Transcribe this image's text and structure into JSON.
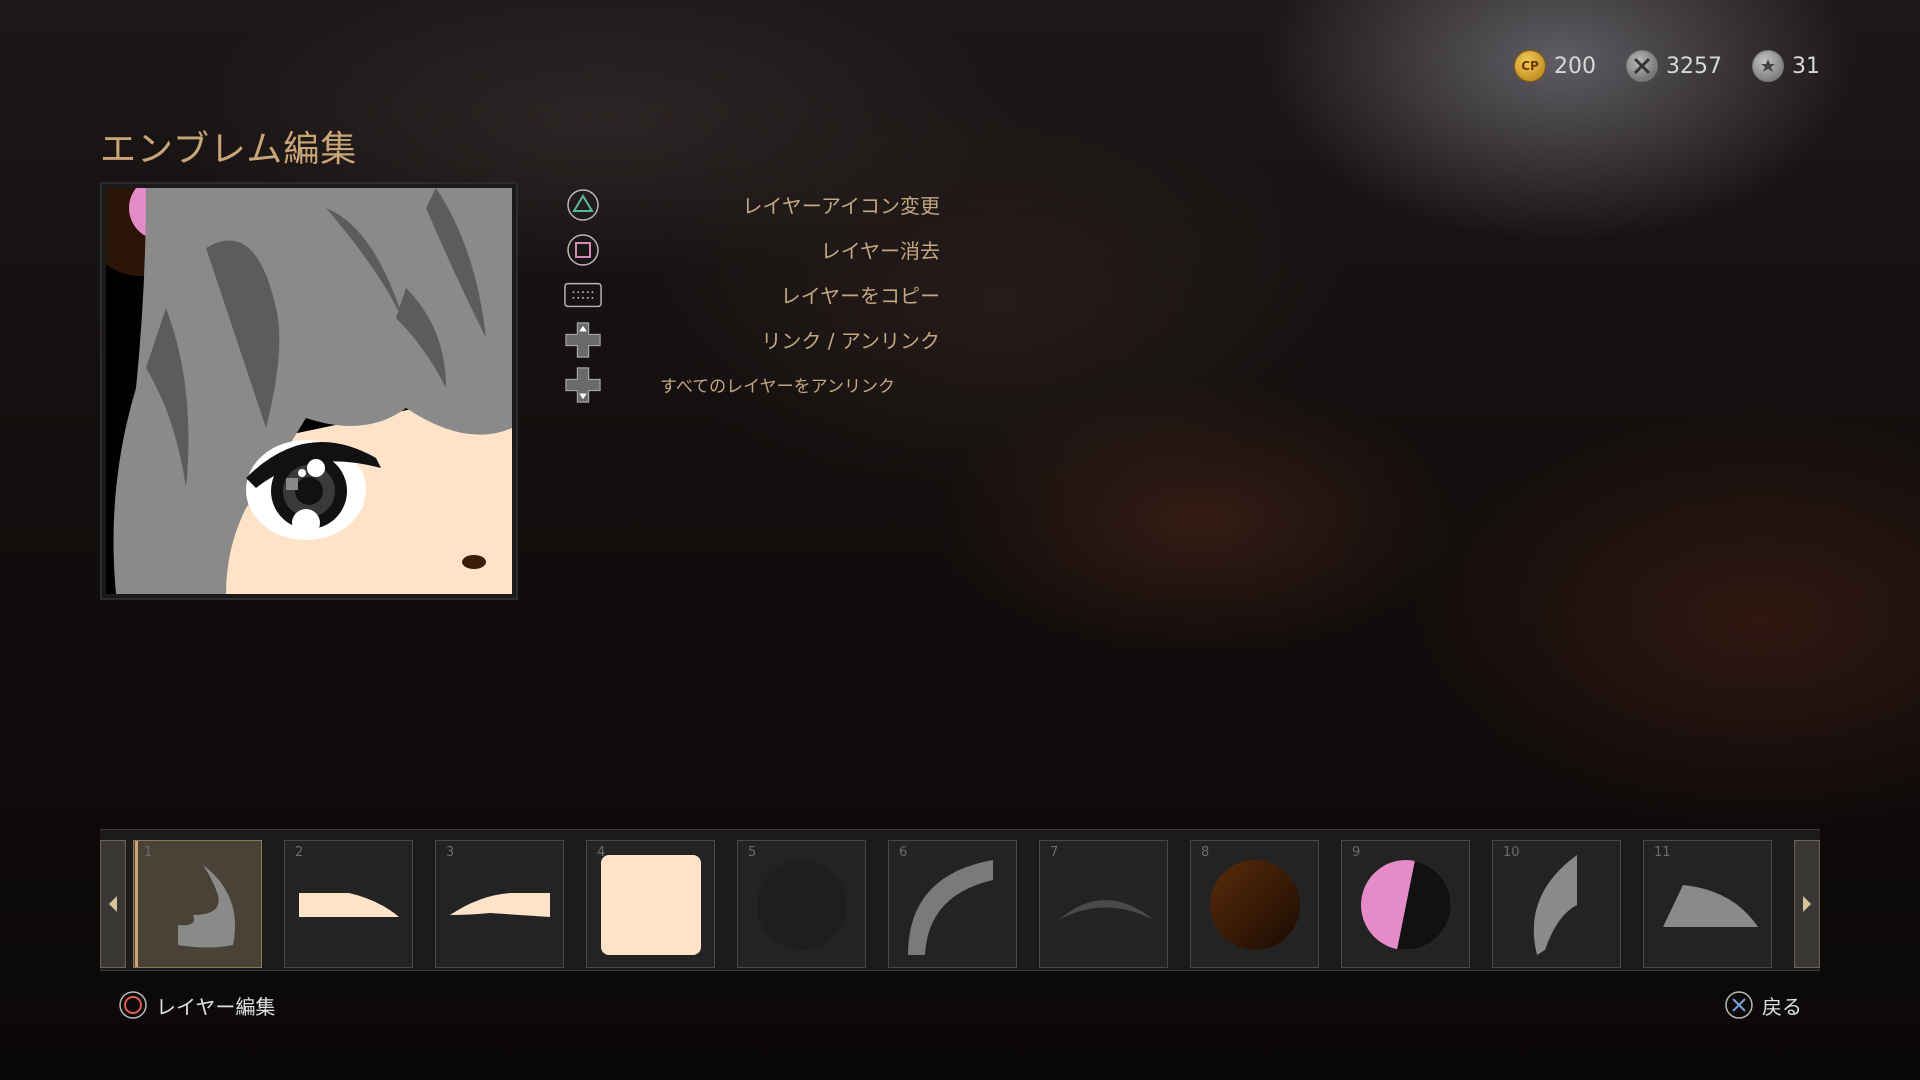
{
  "currency": {
    "cp": {
      "icon": "cp-coin-icon",
      "badge": "CP",
      "value": "200"
    },
    "tools": {
      "icon": "crossed-tools-icon",
      "value": "3257"
    },
    "stars": {
      "icon": "star-medal-icon",
      "value": "31"
    }
  },
  "title": "エンブレム編集",
  "actions": [
    {
      "icon": "triangle-button-icon",
      "label": "レイヤーアイコン変更"
    },
    {
      "icon": "square-button-icon",
      "label": "レイヤー消去"
    },
    {
      "icon": "touchpad-icon",
      "label": "レイヤーをコピー"
    },
    {
      "icon": "dpad-up-icon",
      "label": "リンク / アンリンク"
    },
    {
      "icon": "dpad-down-icon",
      "label": "すべてのレイヤーをアンリンク"
    }
  ],
  "layers": [
    {
      "num": "1",
      "icon": "hair-curl-shape-icon",
      "color": "#8a8a8a",
      "selected": true
    },
    {
      "num": "2",
      "icon": "eyebrow-shape-icon",
      "color": "#ffe3c9",
      "selected": false
    },
    {
      "num": "3",
      "icon": "eyebrow-shape-icon",
      "color": "#ffe3c9",
      "selected": false
    },
    {
      "num": "4",
      "icon": "rounded-square-icon",
      "color": "#ffe3c9",
      "selected": false
    },
    {
      "num": "5",
      "icon": "circle-icon",
      "color": "#1e1e1e",
      "selected": false
    },
    {
      "num": "6",
      "icon": "arc-shape-icon",
      "color": "#7a7a7a",
      "selected": false
    },
    {
      "num": "7",
      "icon": "thin-arc-icon",
      "color": "#4a4a4a",
      "selected": false
    },
    {
      "num": "8",
      "icon": "circle-icon",
      "color": "#3a1d08",
      "selected": false
    },
    {
      "num": "9",
      "icon": "circle-icon",
      "color": "#e48bc8",
      "selected": false
    },
    {
      "num": "10",
      "icon": "claw-shape-icon",
      "color": "#8a8a8a",
      "selected": false
    },
    {
      "num": "11",
      "icon": "wedge-shape-icon",
      "color": "#8a8a8a",
      "selected": false
    }
  ],
  "footer": {
    "edit_label": "レイヤー編集",
    "edit_icon": "circle-button-icon",
    "back_label": "戻る",
    "back_icon": "cross-button-icon"
  },
  "colors": {
    "accent": "#c9a677",
    "label": "#c4a681"
  }
}
